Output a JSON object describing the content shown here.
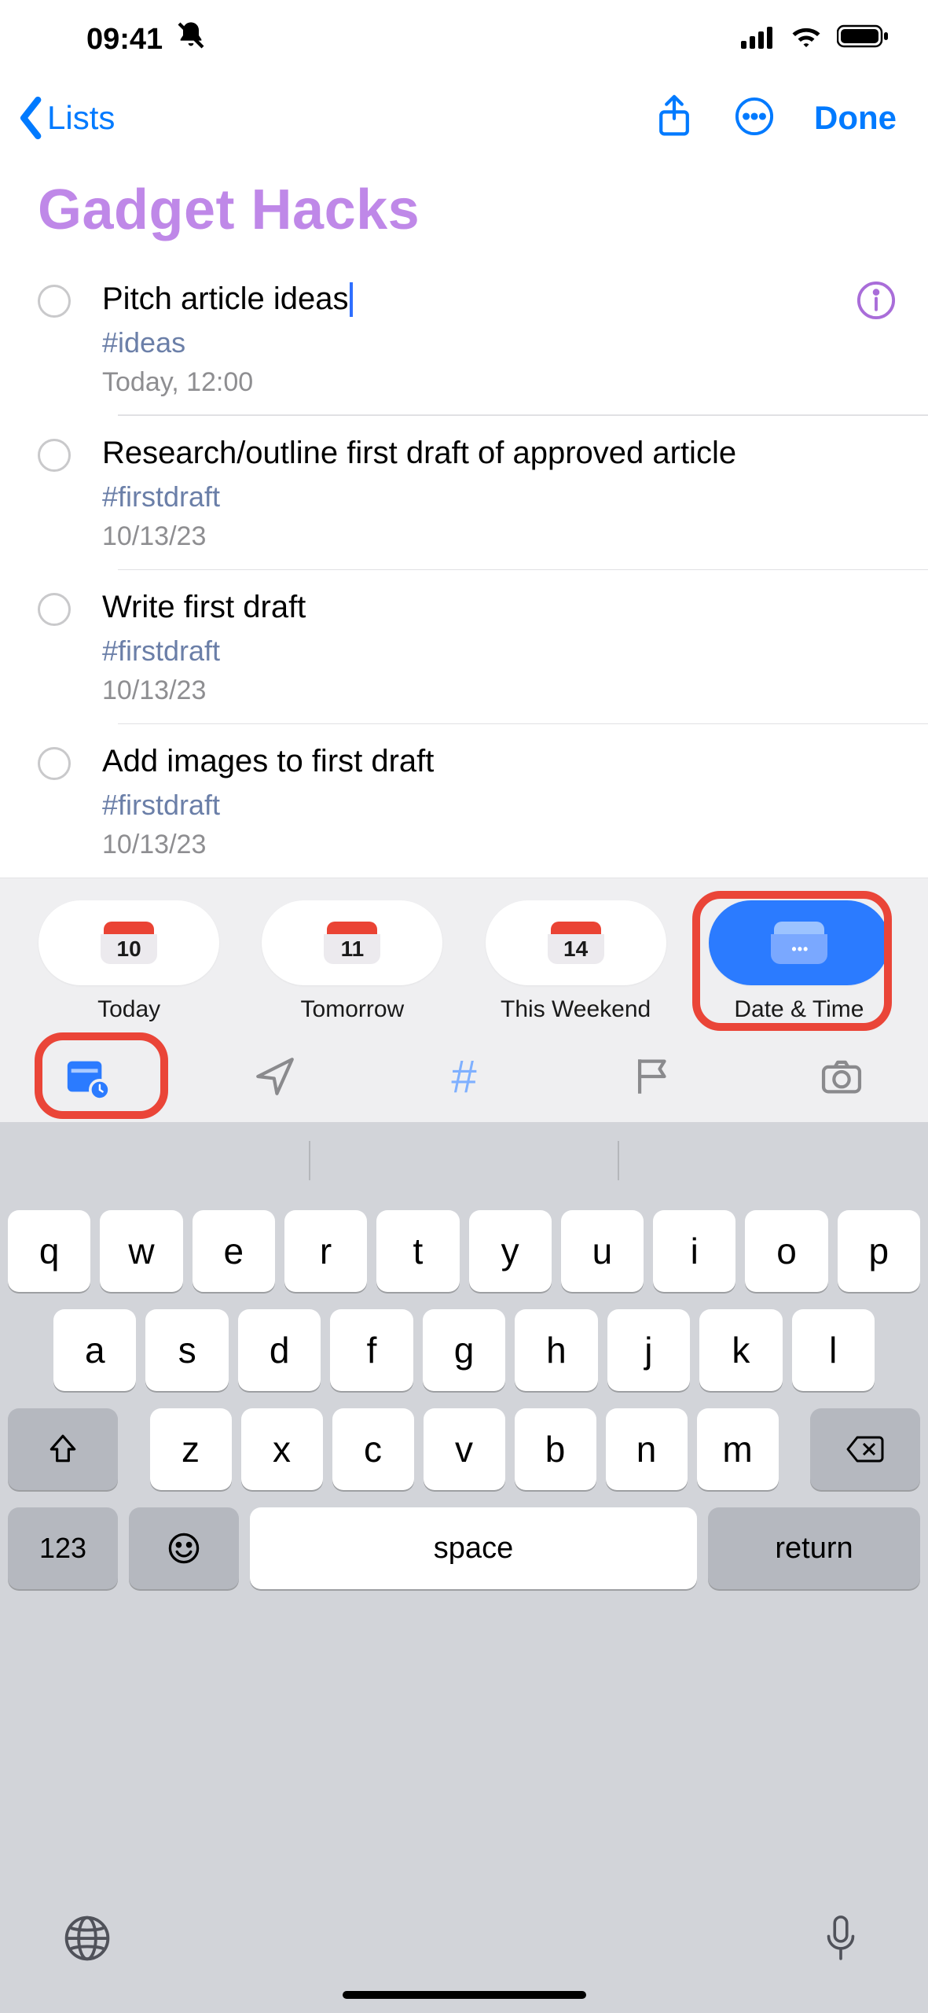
{
  "status": {
    "time": "09:41"
  },
  "nav": {
    "back_label": "Lists",
    "done_label": "Done"
  },
  "title": "Gadget Hacks",
  "reminders": [
    {
      "title": "Pitch article ideas",
      "tag": "#ideas",
      "meta": "Today, 12:00",
      "editing": true
    },
    {
      "title": "Research/outline first draft of approved article",
      "tag": "#firstdraft",
      "meta": "10/13/23"
    },
    {
      "title": "Write first draft",
      "tag": "#firstdraft",
      "meta": "10/13/23"
    },
    {
      "title": "Add images to first draft",
      "tag": "#firstdraft",
      "meta": "10/13/23"
    }
  ],
  "quick": {
    "today": {
      "day": "10",
      "label": "Today"
    },
    "tomorrow": {
      "day": "11",
      "label": "Tomorrow"
    },
    "weekend": {
      "day": "14",
      "label": "This Weekend"
    },
    "datetime": {
      "label": "Date & Time"
    }
  },
  "keyboard": {
    "row1": [
      "q",
      "w",
      "e",
      "r",
      "t",
      "y",
      "u",
      "i",
      "o",
      "p"
    ],
    "row2": [
      "a",
      "s",
      "d",
      "f",
      "g",
      "h",
      "j",
      "k",
      "l"
    ],
    "row3": [
      "z",
      "x",
      "c",
      "v",
      "b",
      "n",
      "m"
    ],
    "numbers_label": "123",
    "space_label": "space",
    "return_label": "return"
  }
}
